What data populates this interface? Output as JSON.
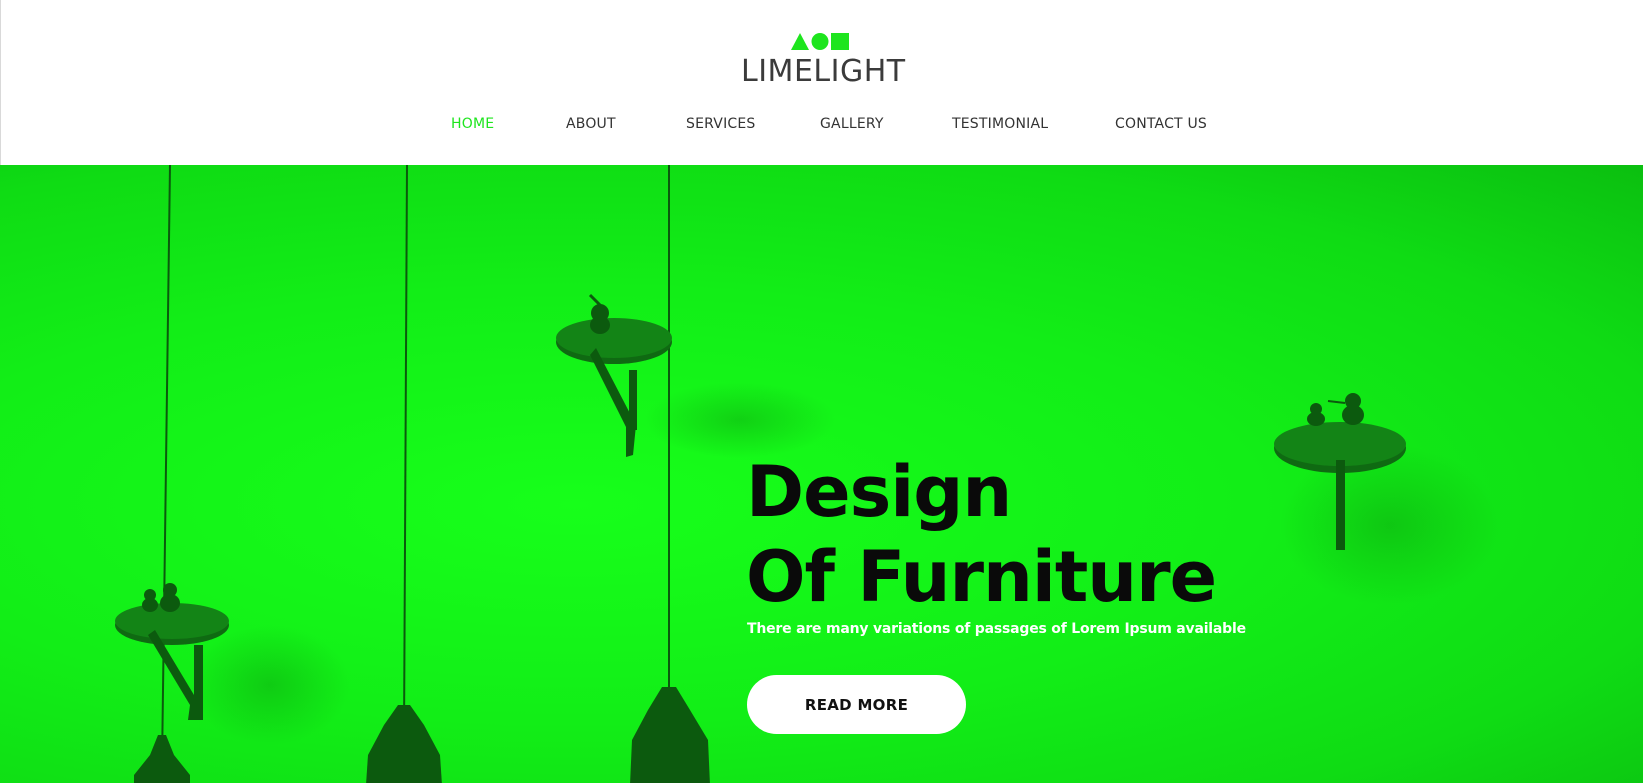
{
  "brand": {
    "name": "LIMELIGHT",
    "mark_icon": "triangle-circle-square-logo-icon",
    "accent_color": "#1ee51e"
  },
  "nav": {
    "items": [
      {
        "label": "HOME",
        "active": true
      },
      {
        "label": "ABOUT",
        "active": false
      },
      {
        "label": "SERVICES",
        "active": false
      },
      {
        "label": "GALLERY",
        "active": false
      },
      {
        "label": "TESTIMONIAL",
        "active": false
      },
      {
        "label": "CONTACT US",
        "active": false
      }
    ]
  },
  "hero": {
    "title_line1": "Design",
    "title_line2": "Of Furniture",
    "subtitle": "There are many variations of passages of Lorem Ipsum available",
    "cta_label": "READ MORE",
    "background_color": "#12ee17"
  }
}
